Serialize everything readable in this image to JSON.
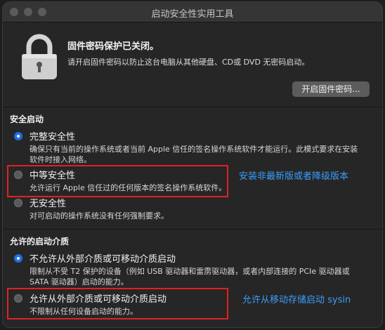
{
  "window": {
    "title": "启动安全性实用工具"
  },
  "firmware": {
    "title": "固件密码保护已关闭。",
    "description": "请开启固件密码以防止这台电脑从其他硬盘、CD或 DVD 无密码启动。",
    "button_label": "开启固件密码..."
  },
  "secure_boot": {
    "heading": "安全启动",
    "options": [
      {
        "label": "完整安全性",
        "description": "确保只有当前的操作系统或者当前 Apple 信任的签名操作系统软件才能运行。此模式要求在安装软件时接入网络。",
        "selected": true
      },
      {
        "label": "中等安全性",
        "description": "允许运行 Apple 信任过的任何版本的签名操作系统软件。",
        "selected": false
      },
      {
        "label": "无安全性",
        "description": "对可启动的操作系统没有任何强制要求。",
        "selected": false
      }
    ]
  },
  "boot_media": {
    "heading": "允许的启动介质",
    "options": [
      {
        "label": "不允许从外部介质或可移动介质启动",
        "description": "限制从不受 T2 保护的设备（例如 USB 驱动器和雷雳驱动器，或者内部连接的 PCIe 驱动器或 SATA 驱动器）启动的能力。",
        "selected": true
      },
      {
        "label": "允许从外部介质或可移动介质启动",
        "description": "不限制从任何设备启动的能力。",
        "selected": false
      }
    ]
  },
  "annotations": {
    "medium": "安装非最新版或者降级版本",
    "external": "允许从移动存储启动 sysin"
  },
  "colors": {
    "accent": "#1f6fe0",
    "highlight": "#e02222",
    "annotation": "#3b9eff"
  }
}
